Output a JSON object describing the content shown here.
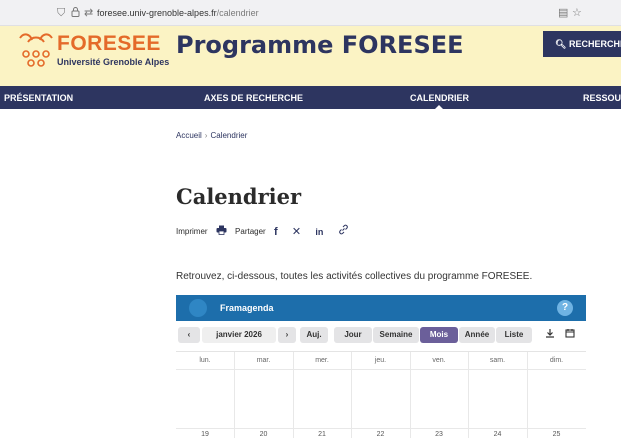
{
  "browser": {
    "url_host": "foresee.univ-grenoble-alpes.fr",
    "url_path": "/calendrier",
    "icons": [
      "shield-icon",
      "lock-icon",
      "tracking-icon",
      "reader-mode-icon",
      "bookmark-star-icon"
    ]
  },
  "header": {
    "logo_name": "FORESEE",
    "logo_sub": "Université Grenoble Alpes",
    "program_title": "Programme FORESEE",
    "search_label": "RECHERCHE"
  },
  "nav": {
    "items": [
      {
        "label": "PRÉSENTATION"
      },
      {
        "label": "AXES DE RECHERCHE"
      },
      {
        "label": "CALENDRIER"
      },
      {
        "label": "RESSOUR"
      }
    ],
    "active": "CALENDRIER"
  },
  "breadcrumb": {
    "home": "Accueil",
    "separator": "›",
    "current": "Calendrier"
  },
  "page": {
    "title": "Calendrier",
    "print_label": "Imprimer",
    "share_label": "Partager",
    "share_icons": [
      "facebook-icon",
      "x-icon",
      "linkedin-icon",
      "link-icon"
    ],
    "intro": "Retrouvez, ci-dessous, toutes les activités collectives du programme FORESEE."
  },
  "calendar": {
    "brand": "Framagenda",
    "help": "?",
    "prev": "‹",
    "next": "›",
    "month_label": "janvier 2026",
    "today_label": "Auj.",
    "views": [
      {
        "label": "Jour"
      },
      {
        "label": "Semaine"
      },
      {
        "label": "Mois"
      },
      {
        "label": "Année"
      },
      {
        "label": "Liste"
      }
    ],
    "active_view": "Mois",
    "weekdays": [
      "lun.",
      "mar.",
      "mer.",
      "jeu.",
      "ven.",
      "sam.",
      "dim."
    ],
    "second_row_days": [
      "19",
      "20",
      "21",
      "22",
      "23",
      "24",
      "25"
    ],
    "colors": {
      "header": "#1d6eab",
      "active_view": "#6b5f9a",
      "nav": "#2d3560",
      "accent": "#e46a2a",
      "header_bg": "#fbf3c4"
    }
  }
}
